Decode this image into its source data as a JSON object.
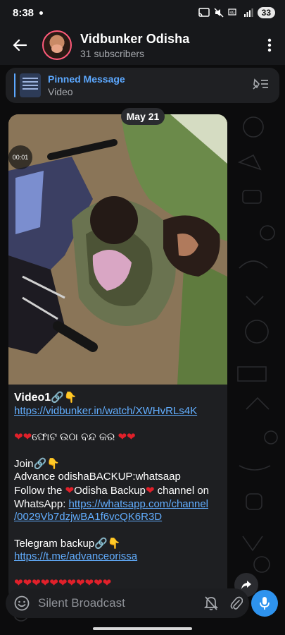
{
  "status_bar": {
    "time": "8:38",
    "signal_label": "VoLTE",
    "battery": "33"
  },
  "header": {
    "title": "Vidbunker Odisha",
    "subtitle": "31 subscribers"
  },
  "pinned": {
    "title": "Pinned Message",
    "subtitle": "Video"
  },
  "date_chip": "May 21",
  "message": {
    "video_duration": "00:01",
    "title": "Video1",
    "link1": "https://vidbunker.in/watch/XWHvRLs4K",
    "odia_line": "ଫୋଟ ଉଠା ବନ୍ଦ କର",
    "join_label": "Join",
    "backup_line": "Advance odishaBACKUP:whatsaap",
    "follow_pre": "Follow the ",
    "follow_name": "Odisha Backup",
    "follow_post": " channel on WhatsApp: ",
    "whatsapp_link_1": "https://whatsapp.com/channel",
    "whatsapp_link_2": "/0029Vb7dzjwBA1f6vcQK6R3D",
    "telegram_label": "Telegram backup",
    "telegram_link": "https://t.me/advanceorissa"
  },
  "input": {
    "placeholder": "Silent Broadcast"
  },
  "icons": {
    "back": "arrow-left-icon",
    "more": "more-vertical-icon",
    "unpin": "pin-list-icon",
    "emoji": "smile-icon",
    "silent": "bell-off-icon",
    "attach": "paperclip-icon",
    "mic": "mic-icon",
    "share": "share-icon",
    "link": "link-emoji",
    "point_down": "point-down-emoji",
    "heart": "red-heart-emoji"
  },
  "colors": {
    "link": "#62aeff",
    "accent": "#2e93ee",
    "pinned_title": "#5ca8ff",
    "heart": "#e0202a"
  }
}
